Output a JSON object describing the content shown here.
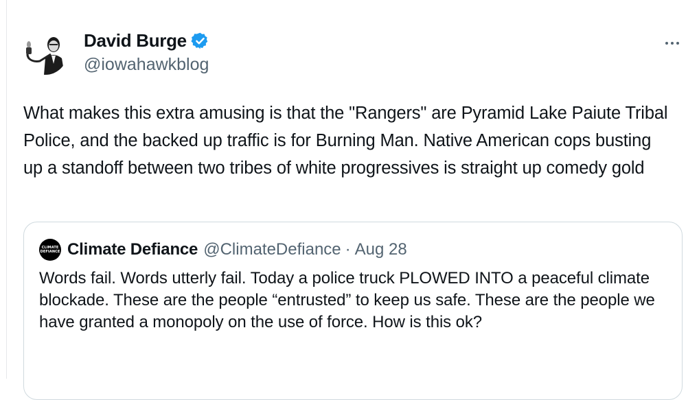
{
  "tweet": {
    "author_name": "David Burge",
    "verified_icon": "verified-badge-icon",
    "handle": "@iowahawkblog",
    "text": "What makes this extra amusing is that the \"Rangers\" are Pyramid Lake Paiute Tribal Police, and the backed up traffic is for Burning Man. Native American cops busting up a standoff between two tribes of white progressives is straight up comedy gold",
    "more_icon": "more-options-icon"
  },
  "quote": {
    "avatar_text": [
      "CLIMATE",
      "DEFIANCE"
    ],
    "author_name": "Climate Defiance",
    "handle": "@ClimateDefiance",
    "separator": "·",
    "date": "Aug 28",
    "text": "Words fail. Words utterly fail. Today a police truck PLOWED INTO a peaceful climate blockade. These are the people “entrusted” to keep us safe. These are the people we have granted a monopoly on the use of force. How is this ok?"
  },
  "colors": {
    "text_primary": "#0f1419",
    "text_secondary": "#536471",
    "verified_blue": "#1d9bf0",
    "border": "#cfd9de"
  }
}
